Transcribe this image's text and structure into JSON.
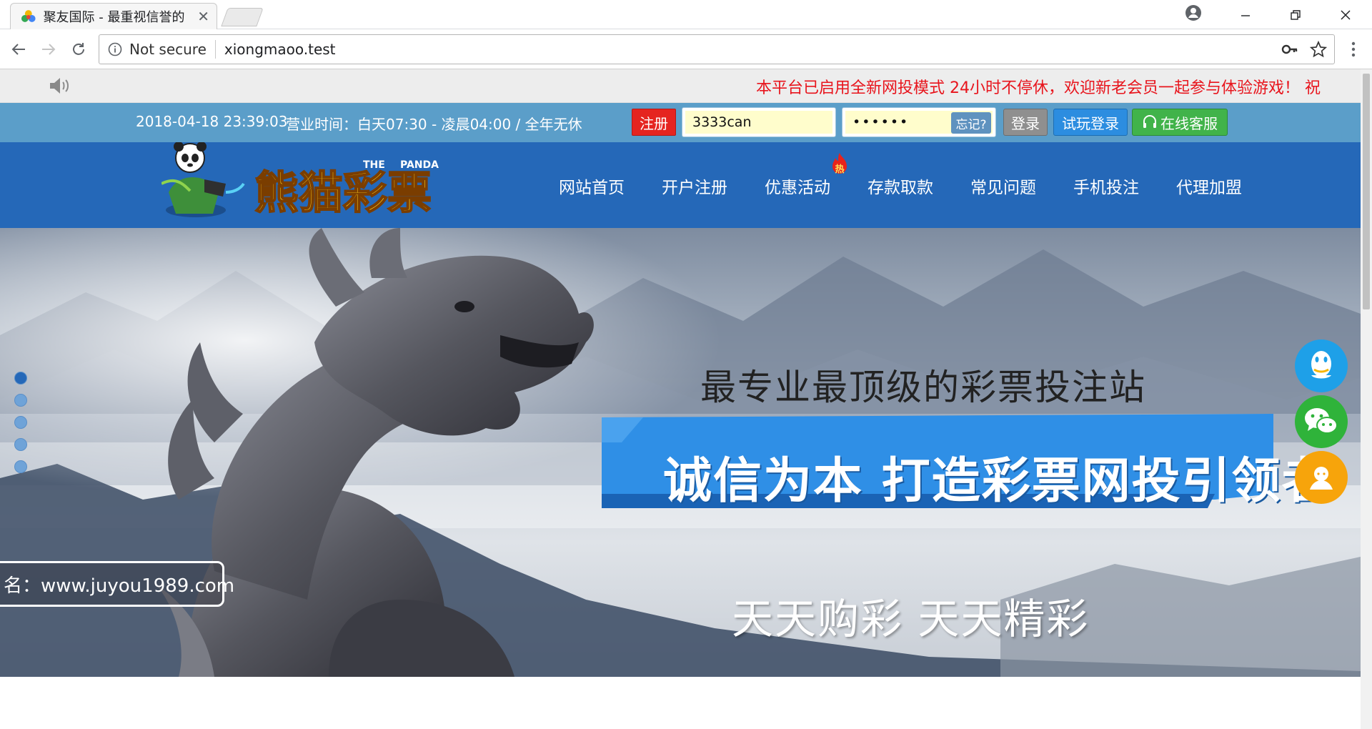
{
  "browser": {
    "tab_title": "聚友国际 - 最重视信誉的",
    "security_label": "Not secure",
    "url": "xiongmaoo.test"
  },
  "notice": {
    "marquee": "本平台已启用全新网投模式 24小时不停休，欢迎新老会员一起参与体验游戏！ 祝"
  },
  "topbar": {
    "datetime": "2018-04-18 23:39:03",
    "hours": "营业时间：白天07:30 - 凌晨04:00 / 全年无休",
    "register_label": "注册",
    "username_value": "3333can",
    "password_value": "••••••",
    "forgot_label": "忘记?",
    "login_label": "登录",
    "trial_label": "试玩登录",
    "service_label": "在线客服"
  },
  "nav": {
    "items": [
      {
        "label": "网站首页"
      },
      {
        "label": "开户注册"
      },
      {
        "label": "优惠活动"
      },
      {
        "label": "存款取款"
      },
      {
        "label": "常见问题"
      },
      {
        "label": "手机投注"
      },
      {
        "label": "代理加盟"
      }
    ],
    "hot_badge": "热"
  },
  "logo": {
    "text": "熊猫彩票",
    "en_the": "THE",
    "en_panda": "PANDA"
  },
  "banner": {
    "slogan_1": "最专业最顶级的彩票投注站",
    "slogan_2": "诚信为本 打造彩票网投引领者",
    "slogan_3": "天天购彩 天天精彩",
    "domain": "名：www.juyou1989.com",
    "slide_count": 5,
    "active_slide": 1
  },
  "colors": {
    "notice_text": "#e8141c",
    "topbar_bg": "#5b9ec9",
    "nav_bg": "#2568b8",
    "register_btn": "#e52420",
    "trial_btn": "#2c8de0",
    "service_btn": "#41b34a",
    "qq_btn": "#1ea0e8",
    "wechat_btn": "#2fb33a",
    "contact_btn": "#f7a40b"
  },
  "icons": {
    "speaker": "speaker-icon",
    "headset": "headset-icon",
    "qq": "qq-icon",
    "wechat": "wechat-icon",
    "contact": "contact-person-icon"
  }
}
